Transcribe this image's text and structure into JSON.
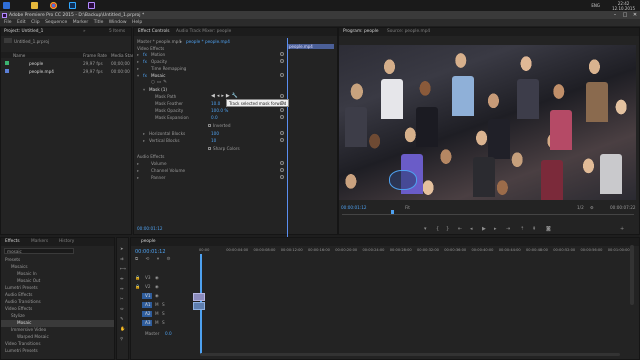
{
  "taskbar": {
    "icons": [
      "windows-logo-icon",
      "file-explorer-icon",
      "chrome-icon",
      "photoshop-icon",
      "premiere-icon"
    ],
    "lang": "ENG",
    "time": "22:42",
    "date": "12.10.2015"
  },
  "window": {
    "title": "Adobe Premiere Pro CC 2015 - D:\\Backup\\Untitled_1.prproj *",
    "minimize": "–",
    "maximize": "□",
    "close": "✕"
  },
  "menu": [
    "File",
    "Edit",
    "Clip",
    "Sequence",
    "Marker",
    "Title",
    "Window",
    "Help"
  ],
  "project": {
    "tab_title": "Project: Untitled_1",
    "tab_more": "»",
    "other_tab": "5 Items",
    "search_name": "Untitled_1.prproj",
    "columns": [
      "Name",
      "Frame Rate",
      "Media Start"
    ],
    "items": [
      {
        "name": "people",
        "fps": "29,97 fps",
        "start": "00;00;00",
        "color": "#3cb371"
      },
      {
        "name": "people.mp4",
        "fps": "29,97 fps",
        "start": "00:00:00",
        "color": "#5b7fd6"
      }
    ]
  },
  "effect_controls": {
    "tabs": [
      "Effect Controls",
      "Audio Track Mixer: people"
    ],
    "source_label": "Master * people.mp4",
    "source_arrow": "▸",
    "sequence_label": "people * people.mp4",
    "clip_label": "people.mp4",
    "section_video": "Video Effects",
    "rows": [
      {
        "label": "Motion",
        "fx": "fx"
      },
      {
        "label": "Opacity",
        "fx": "fx"
      },
      {
        "label": "Time Remapping",
        "fx": ""
      },
      {
        "label": "Mosaic",
        "fx": "fx"
      },
      {
        "label": "Mask (1)",
        "fx": ""
      },
      {
        "label": "Mask Path",
        "fx": ""
      },
      {
        "label": "Mask Feather",
        "value": "10.0"
      },
      {
        "label": "Mask Opacity",
        "value": "100.0 %"
      },
      {
        "label": "Mask Expansion",
        "value": "0.0"
      },
      {
        "label": "Inverted",
        "value": ""
      },
      {
        "label": "Horizontal Blocks",
        "value": "100"
      },
      {
        "label": "Vertical Blocks",
        "value": "10"
      },
      {
        "label": "Sharp Colors",
        "value": ""
      }
    ],
    "section_audio": "Audio Effects",
    "audio_rows": [
      "Volume",
      "Channel Volume",
      "Panner"
    ],
    "tooltip": "Track selected mask forward",
    "timecode": "00:00:01:12"
  },
  "program": {
    "tabs": [
      "Program: people",
      "Source: people.mp4"
    ],
    "timecode_left": "00:00:01:12",
    "fit": "Fit",
    "quality": "1/2",
    "timecode_right": "00:00:07:22"
  },
  "effects_panel": {
    "tabs": [
      "Effects",
      "Markers",
      "History"
    ],
    "search": "mosaic",
    "tree": [
      {
        "label": "Presets",
        "level": 0
      },
      {
        "label": "Mosaics",
        "level": 1
      },
      {
        "label": "Mosaic In",
        "level": 2
      },
      {
        "label": "Mosaic Out",
        "level": 2
      },
      {
        "label": "Lumetri Presets",
        "level": 0
      },
      {
        "label": "Audio Effects",
        "level": 0
      },
      {
        "label": "Audio Transitions",
        "level": 0
      },
      {
        "label": "Video Effects",
        "level": 0
      },
      {
        "label": "Stylize",
        "level": 1
      },
      {
        "label": "Mosaic",
        "level": 2
      },
      {
        "label": "Immersive Video",
        "level": 1
      },
      {
        "label": "Warped Mosaic",
        "level": 2
      },
      {
        "label": "Video Transitions",
        "level": 0
      },
      {
        "label": "Lumetri Presets",
        "level": 0
      }
    ]
  },
  "timeline": {
    "tab": "people",
    "timecode": "00:00:01:12",
    "ruler": [
      "00:00",
      "00:00:04:00",
      "00:00:08:00",
      "00:00:12:00",
      "00:00:16:00",
      "00:00:20:00",
      "00:00:24:00",
      "00:00:28:00",
      "00:00:32:00",
      "00:00:36:00",
      "00:00:40:00",
      "00:00:44:00",
      "00:00:48:00",
      "00:00:52:00",
      "00:00:56:00",
      "00:01:00:00"
    ],
    "tracks": [
      "V3",
      "V2",
      "V1",
      "A1",
      "A2",
      "A3"
    ],
    "master_label": "Master",
    "master_value": "0.0"
  }
}
